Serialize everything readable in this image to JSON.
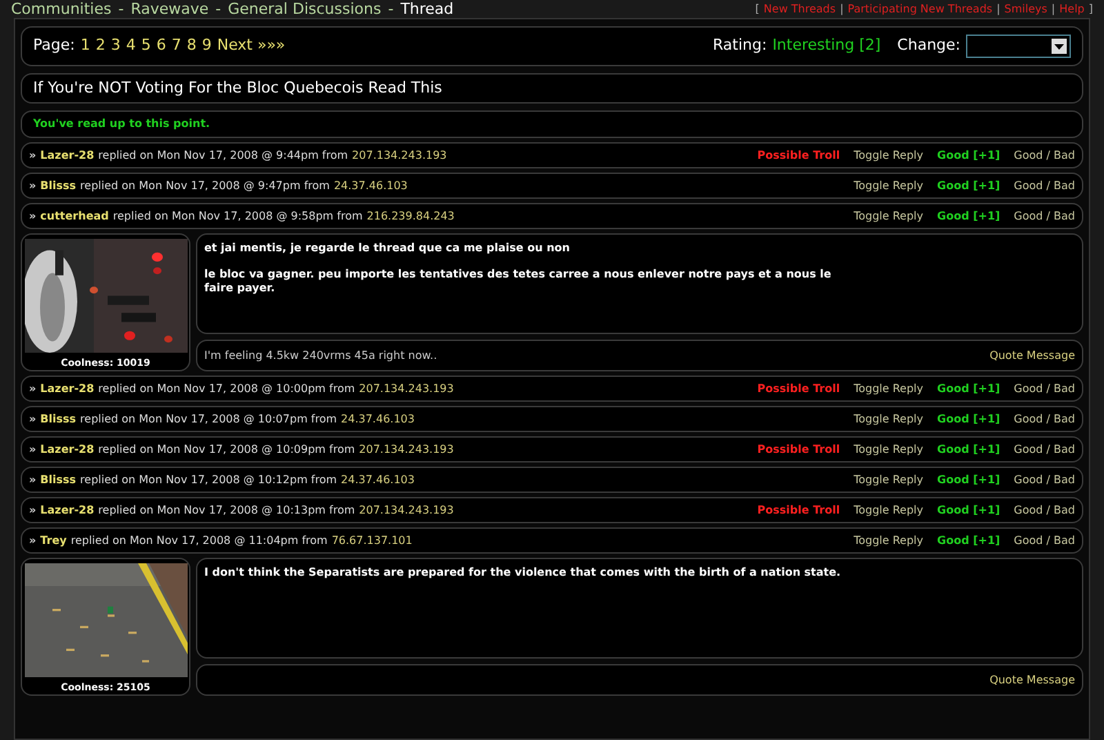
{
  "breadcrumb": {
    "separator": "-",
    "items": [
      {
        "label": "Communities",
        "current": false
      },
      {
        "label": "Ravewave",
        "current": false
      },
      {
        "label": "General Discussions",
        "current": false
      },
      {
        "label": "Thread",
        "current": true
      }
    ]
  },
  "top_links": {
    "open": "[",
    "close": "]",
    "separator": "|",
    "items": [
      "New Threads",
      "Participating New Threads",
      "Smileys",
      "Help"
    ]
  },
  "pagination": {
    "label": "Page:",
    "pages": [
      "1",
      "2",
      "3",
      "4",
      "5",
      "6",
      "7",
      "8",
      "9"
    ],
    "next": "Next »»»"
  },
  "rating": {
    "label": "Rating:",
    "value": "Interesting [2]"
  },
  "change": {
    "label": "Change:"
  },
  "thread_title": "If You're NOT Voting For the Bloc Quebecois Read This",
  "read_marker": "You've read up to this point.",
  "replies": [
    {
      "kind": "header",
      "marker": "»",
      "author": "Lazer-28",
      "text": "replied on Mon Nov 17, 2008 @ 9:44pm from",
      "ip": "207.134.243.193",
      "flag": "Possible Troll",
      "toggle": "Toggle Reply",
      "score": "Good [+1]",
      "vote": "Good / Bad"
    },
    {
      "kind": "header",
      "marker": "»",
      "author": "Blisss",
      "text": "replied on Mon Nov 17, 2008 @ 9:47pm from",
      "ip": "24.37.46.103",
      "toggle": "Toggle Reply",
      "score": "Good [+1]",
      "vote": "Good / Bad"
    },
    {
      "kind": "header",
      "marker": "»",
      "author": "cutterhead",
      "text": "replied on Mon Nov 17, 2008 @ 9:58pm from",
      "ip": "216.239.84.243",
      "toggle": "Toggle Reply",
      "score": "Good [+1]",
      "vote": "Good / Bad"
    },
    {
      "kind": "post",
      "coolness": "Coolness: 10019",
      "paragraphs": [
        "et jai mentis, je regarde le thread que ca me plaise ou non",
        "le bloc va gagner. peu importe les tentatives des tetes carree a nous enlever notre pays et a nous le faire payer."
      ],
      "signature": "I'm feeling 4.5kw 240vrms 45a right now..",
      "quote": "Quote Message"
    },
    {
      "kind": "header",
      "marker": "»",
      "author": "Lazer-28",
      "text": "replied on Mon Nov 17, 2008 @ 10:00pm from",
      "ip": "207.134.243.193",
      "flag": "Possible Troll",
      "toggle": "Toggle Reply",
      "score": "Good [+1]",
      "vote": "Good / Bad"
    },
    {
      "kind": "header",
      "marker": "»",
      "author": "Blisss",
      "text": "replied on Mon Nov 17, 2008 @ 10:07pm from",
      "ip": "24.37.46.103",
      "toggle": "Toggle Reply",
      "score": "Good [+1]",
      "vote": "Good / Bad"
    },
    {
      "kind": "header",
      "marker": "»",
      "author": "Lazer-28",
      "text": "replied on Mon Nov 17, 2008 @ 10:09pm from",
      "ip": "207.134.243.193",
      "flag": "Possible Troll",
      "toggle": "Toggle Reply",
      "score": "Good [+1]",
      "vote": "Good / Bad"
    },
    {
      "kind": "header",
      "marker": "»",
      "author": "Blisss",
      "text": "replied on Mon Nov 17, 2008 @ 10:12pm from",
      "ip": "24.37.46.103",
      "toggle": "Toggle Reply",
      "score": "Good [+1]",
      "vote": "Good / Bad"
    },
    {
      "kind": "header",
      "marker": "»",
      "author": "Lazer-28",
      "text": "replied on Mon Nov 17, 2008 @ 10:13pm from",
      "ip": "207.134.243.193",
      "flag": "Possible Troll",
      "toggle": "Toggle Reply",
      "score": "Good [+1]",
      "vote": "Good / Bad"
    },
    {
      "kind": "header",
      "marker": "»",
      "author": "Trey",
      "text": "replied on Mon Nov 17, 2008 @ 11:04pm from",
      "ip": "76.67.137.101",
      "toggle": "Toggle Reply",
      "score": "Good [+1]",
      "vote": "Good / Bad"
    },
    {
      "kind": "post",
      "coolness": "Coolness: 25105",
      "paragraphs": [
        "I don't think the Separatists are prepared for the violence that comes with the birth of a nation state."
      ],
      "quote": "Quote Message"
    }
  ]
}
